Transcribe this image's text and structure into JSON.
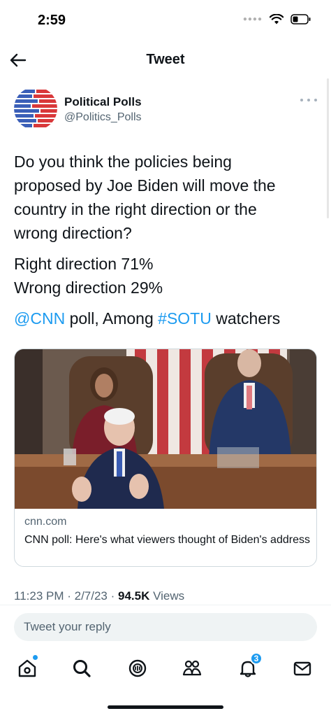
{
  "status_bar": {
    "time": "2:59"
  },
  "header": {
    "title": "Tweet"
  },
  "tweet": {
    "author_name": "Political Polls",
    "author_handle": "@Politics_Polls",
    "question_lines": [
      "Do you think the policies being",
      "proposed by Joe Biden will move the",
      "country in the right direction or the",
      "wrong direction?"
    ],
    "result_right": "Right direction 71%",
    "result_wrong": "Wrong direction 29%",
    "source_mention": "@CNN",
    "source_middle": " poll, Among ",
    "source_hashtag": "#SOTU",
    "source_end": " watchers",
    "card": {
      "domain": "cnn.com",
      "title": "CNN poll: Here's what viewers thought of Biden's address"
    },
    "time": "11:23 PM",
    "date": "2/7/23",
    "views_count": "94.5K",
    "views_label": "Views"
  },
  "reply": {
    "placeholder": "Tweet your reply"
  },
  "nav": {
    "notifications_badge": "3",
    "items": [
      "home-icon",
      "search-icon",
      "spaces-icon",
      "communities-icon",
      "notifications-icon",
      "messages-icon"
    ]
  },
  "colors": {
    "accent": "#1d9bf0",
    "text_primary": "#0f1419",
    "text_secondary": "#536471"
  }
}
